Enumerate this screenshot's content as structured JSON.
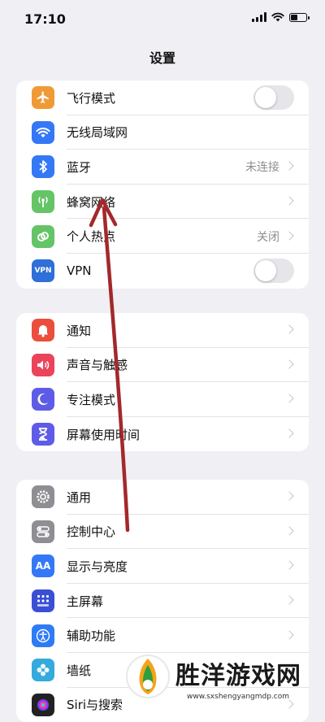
{
  "status_bar": {
    "time": "17:10",
    "battery_level": 0.45
  },
  "header": {
    "title": "设置"
  },
  "groups": [
    {
      "items": [
        {
          "label": "飞行模式",
          "icon": "airplane-icon",
          "color": "#f09a37",
          "control": "toggle",
          "toggle_on": false
        },
        {
          "label": "无线局域网",
          "icon": "wifi-icon",
          "color": "#3478f6",
          "control": "none"
        },
        {
          "label": "蓝牙",
          "icon": "bluetooth-icon",
          "color": "#3478f6",
          "value": "未连接",
          "control": "chevron"
        },
        {
          "label": "蜂窝网络",
          "icon": "antenna-icon",
          "color": "#65c466",
          "control": "chevron"
        },
        {
          "label": "个人热点",
          "icon": "hotspot-icon",
          "color": "#65c466",
          "value": "关闭",
          "control": "chevron"
        },
        {
          "label": "VPN",
          "icon": "vpn-icon",
          "icon_text": "VPN",
          "color": "#2e6fd8",
          "control": "toggle",
          "toggle_on": false
        }
      ]
    },
    {
      "items": [
        {
          "label": "通知",
          "icon": "notification-bell-icon",
          "color": "#eb4e3d",
          "control": "chevron"
        },
        {
          "label": "声音与触感",
          "icon": "speaker-icon",
          "color": "#eb445a",
          "control": "chevron"
        },
        {
          "label": "专注模式",
          "icon": "moon-icon",
          "color": "#5e5ce6",
          "control": "chevron"
        },
        {
          "label": "屏幕使用时间",
          "icon": "hourglass-icon",
          "color": "#5e5ce6",
          "control": "chevron"
        }
      ]
    },
    {
      "items": [
        {
          "label": "通用",
          "icon": "gear-icon",
          "color": "#8e8e93",
          "control": "chevron"
        },
        {
          "label": "控制中心",
          "icon": "switches-icon",
          "color": "#8e8e93",
          "control": "chevron"
        },
        {
          "label": "显示与亮度",
          "icon": "display-brightness-icon",
          "icon_text": "AA",
          "color": "#3478f6",
          "control": "chevron"
        },
        {
          "label": "主屏幕",
          "icon": "home-screen-icon",
          "color": "#3a4fd4",
          "control": "chevron"
        },
        {
          "label": "辅助功能",
          "icon": "accessibility-icon",
          "color": "#2f7bf5",
          "control": "chevron"
        },
        {
          "label": "墙纸",
          "icon": "wallpaper-icon",
          "color": "#35aadc",
          "control": "chevron"
        },
        {
          "label": "Siri与搜索",
          "icon": "siri-icon",
          "color": "#222222",
          "control": "chevron"
        }
      ]
    }
  ],
  "watermark": {
    "brand": "胜洋游戏网",
    "url": "www.sxshengyangmdp.com"
  },
  "annotation": {
    "color": "#a3282b"
  }
}
